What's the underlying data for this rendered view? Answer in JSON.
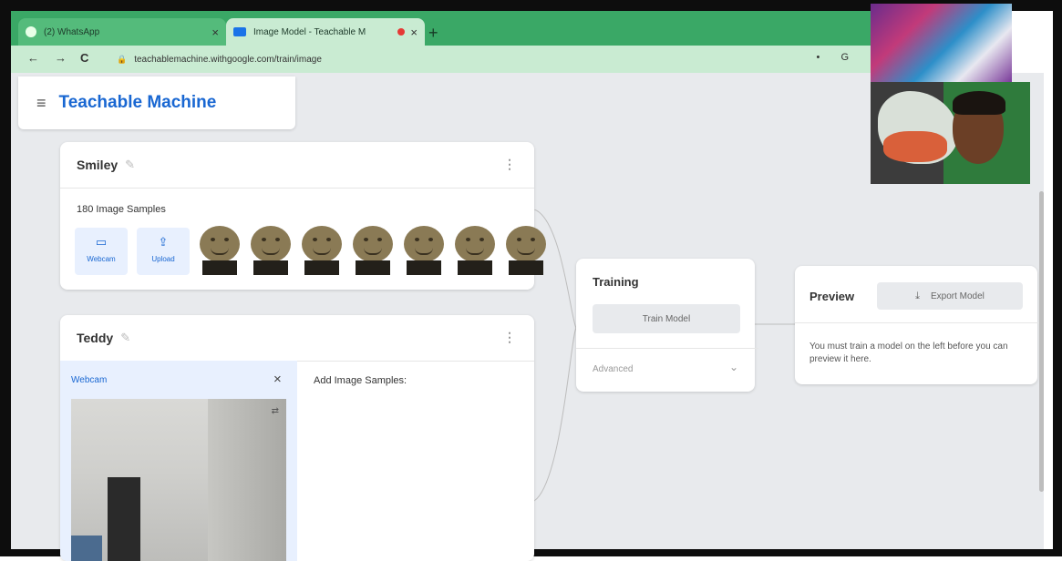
{
  "browser": {
    "tabs": [
      {
        "title": "(2) WhatsApp",
        "close": "×"
      },
      {
        "title": "Image Model - Teachable M",
        "close": "×"
      }
    ],
    "new_tab": "+",
    "url": "teachablemachine.withgoogle.com/train/image",
    "nav": {
      "back": "←",
      "forward": "→",
      "reload": "C"
    },
    "addr_icons": "• G"
  },
  "app": {
    "menu_icon": "≡",
    "brand": "Teachable Machine"
  },
  "classes": [
    {
      "name": "Smiley",
      "sample_count_label": "180 Image Samples",
      "buttons": [
        {
          "label": "Webcam"
        },
        {
          "label": "Upload"
        }
      ],
      "thumbnail_count": 7
    },
    {
      "name": "Teddy",
      "webcam_title": "Webcam",
      "webcam_close": "×",
      "add_label": "Add Image Samples:"
    }
  ],
  "training": {
    "title": "Training",
    "train_button": "Train Model",
    "advanced": "Advanced",
    "advanced_icon": "chevron-down-icon"
  },
  "preview": {
    "title": "Preview",
    "export_button": "Export Model",
    "message": "You must train a model on the left before you can preview it here."
  },
  "colors": {
    "accent": "#1967d2",
    "tabbar": "#3aa866",
    "page_bg": "#e8eaed"
  }
}
